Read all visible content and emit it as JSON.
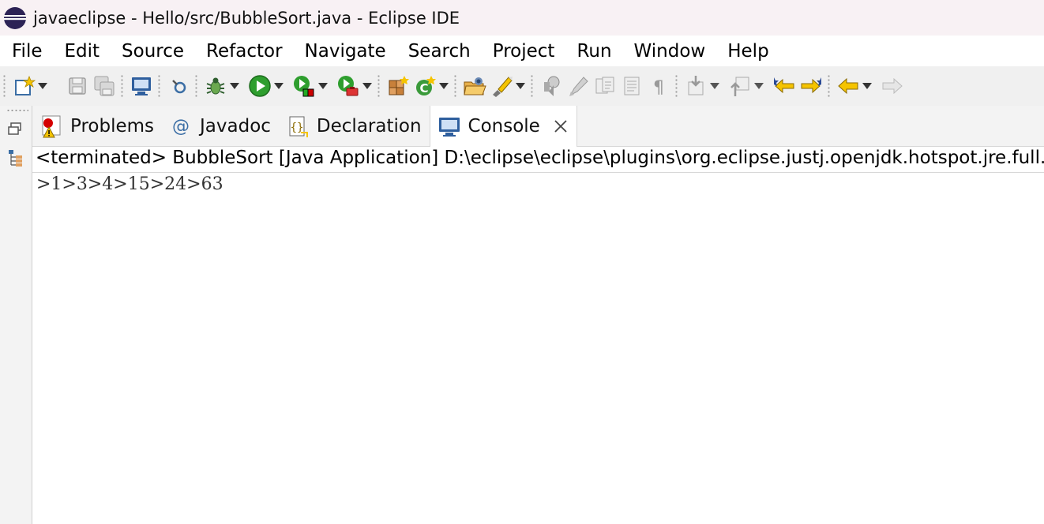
{
  "window": {
    "title": "javaeclipse - Hello/src/BubbleSort.java - Eclipse IDE"
  },
  "menu": [
    "File",
    "Edit",
    "Source",
    "Refactor",
    "Navigate",
    "Search",
    "Project",
    "Run",
    "Window",
    "Help"
  ],
  "toolbar": {
    "icons": [
      "new-wizard-icon",
      "save-icon",
      "save-all-icon",
      "terminal-icon",
      "search-tool-icon",
      "debug-bug-icon",
      "run-icon",
      "coverage-icon",
      "external-tools-icon",
      "new-java-package-icon",
      "new-class-icon",
      "open-type-icon",
      "open-task-icon",
      "toggle-breadcrumb-icon",
      "toggle-highlight-icon",
      "toggle-block-selection-icon",
      "show-whitespace-icon",
      "pilcrow-icon",
      "next-annotation-icon",
      "previous-annotation-icon",
      "last-edit-location-icon",
      "back-icon",
      "forward-icon"
    ]
  },
  "tabs": [
    {
      "label": "Problems",
      "icon": "problems-icon"
    },
    {
      "label": "Javadoc",
      "icon": "javadoc-at-icon"
    },
    {
      "label": "Declaration",
      "icon": "declaration-icon"
    },
    {
      "label": "Console",
      "icon": "console-icon",
      "active": true
    }
  ],
  "console": {
    "header": "<terminated> BubbleSort [Java Application] D:\\eclipse\\eclipse\\plugins\\org.eclipse.justj.openjdk.hotspot.jre.full.w",
    "output": ">1>3>4>15>24>63"
  },
  "colors": {
    "titlebar_bg": "#f8f1f4",
    "toolbar_bg": "#f0f0f0",
    "tab_bar_bg": "#f3f3f3",
    "run_green": "#2e9e2e",
    "eclipse_purple": "#2c2255"
  }
}
